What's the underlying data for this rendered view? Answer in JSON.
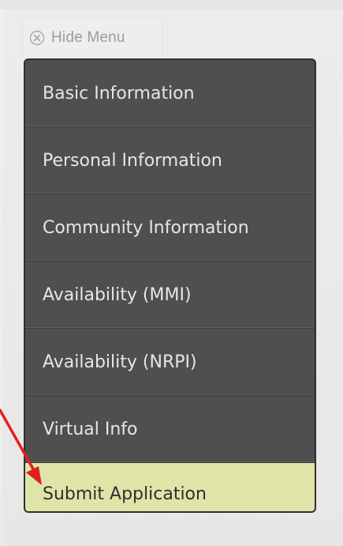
{
  "hide_menu": {
    "icon": "close-circle-icon",
    "label": "Hide Menu"
  },
  "menu": {
    "items": [
      {
        "label": "Basic Information",
        "active": false
      },
      {
        "label": "Personal Information",
        "active": false
      },
      {
        "label": "Community Information",
        "active": false
      },
      {
        "label": "Availability (MMI)",
        "active": false
      },
      {
        "label": "Availability (NRPI)",
        "active": false
      },
      {
        "label": "Virtual Info",
        "active": false
      },
      {
        "label": "Submit Application",
        "active": true
      }
    ]
  },
  "annotation": {
    "arrow_color": "#e21f1f",
    "points_to": "Submit Application"
  },
  "colors": {
    "menu_bg": "#4f4f4f",
    "active_bg": "#dfe4a9",
    "menu_text": "#e6e6e6"
  }
}
